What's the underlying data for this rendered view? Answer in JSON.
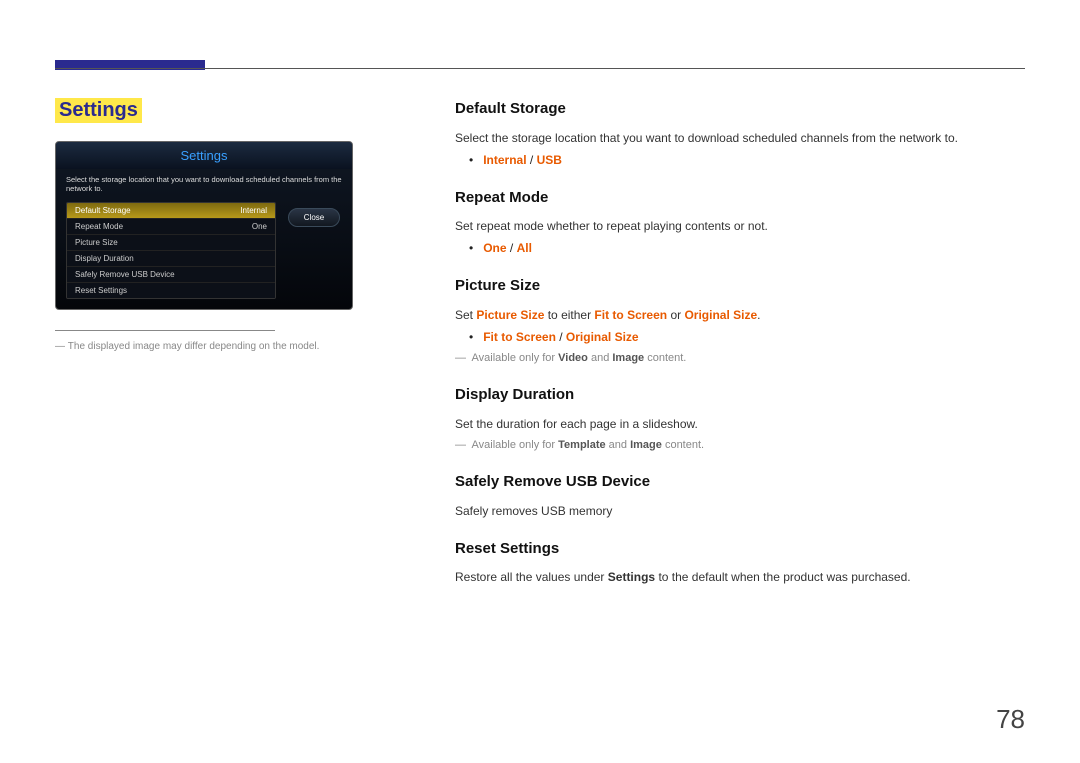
{
  "page_number": "78",
  "left": {
    "title": "Settings",
    "osd": {
      "title": "Settings",
      "description": "Select the storage location that you want to download scheduled channels from the network to.",
      "rows": [
        {
          "label": "Default Storage",
          "value": "Internal",
          "selected": true
        },
        {
          "label": "Repeat Mode",
          "value": "One",
          "selected": false
        },
        {
          "label": "Picture Size",
          "value": "",
          "selected": false
        },
        {
          "label": "Display Duration",
          "value": "",
          "selected": false
        },
        {
          "label": "Safely Remove USB Device",
          "value": "",
          "selected": false
        },
        {
          "label": "Reset Settings",
          "value": "",
          "selected": false
        }
      ],
      "close_label": "Close"
    },
    "footnote": "The displayed image may differ depending on the model."
  },
  "sections": {
    "default_storage": {
      "heading": "Default Storage",
      "desc": "Select the storage location that you want to download scheduled channels from the network to.",
      "opt1": "Internal",
      "opt2": "USB"
    },
    "repeat_mode": {
      "heading": "Repeat Mode",
      "desc": "Set repeat mode whether to repeat playing contents or not.",
      "opt1": "One",
      "opt2": "All"
    },
    "picture_size": {
      "heading": "Picture Size",
      "desc_prefix": "Set ",
      "desc_b1": "Picture Size",
      "desc_mid": " to either ",
      "desc_b2": "Fit to Screen",
      "desc_mid2": " or ",
      "desc_b3": "Original Size",
      "desc_suffix": ".",
      "opt1": "Fit to Screen",
      "opt2": "Original Size",
      "note_prefix": "Available only for ",
      "note_b1": "Video",
      "note_mid": " and ",
      "note_b2": "Image",
      "note_suffix": " content."
    },
    "display_duration": {
      "heading": "Display Duration",
      "desc": "Set the duration for each page in a slideshow.",
      "note_prefix": "Available only for ",
      "note_b1": "Template",
      "note_mid": " and ",
      "note_b2": "Image",
      "note_suffix": " content."
    },
    "safely_remove": {
      "heading": "Safely Remove USB Device",
      "desc": "Safely removes USB memory"
    },
    "reset_settings": {
      "heading": "Reset Settings",
      "desc_prefix": "Restore all the values under ",
      "desc_b1": "Settings",
      "desc_suffix": " to the default when the product was purchased."
    }
  }
}
